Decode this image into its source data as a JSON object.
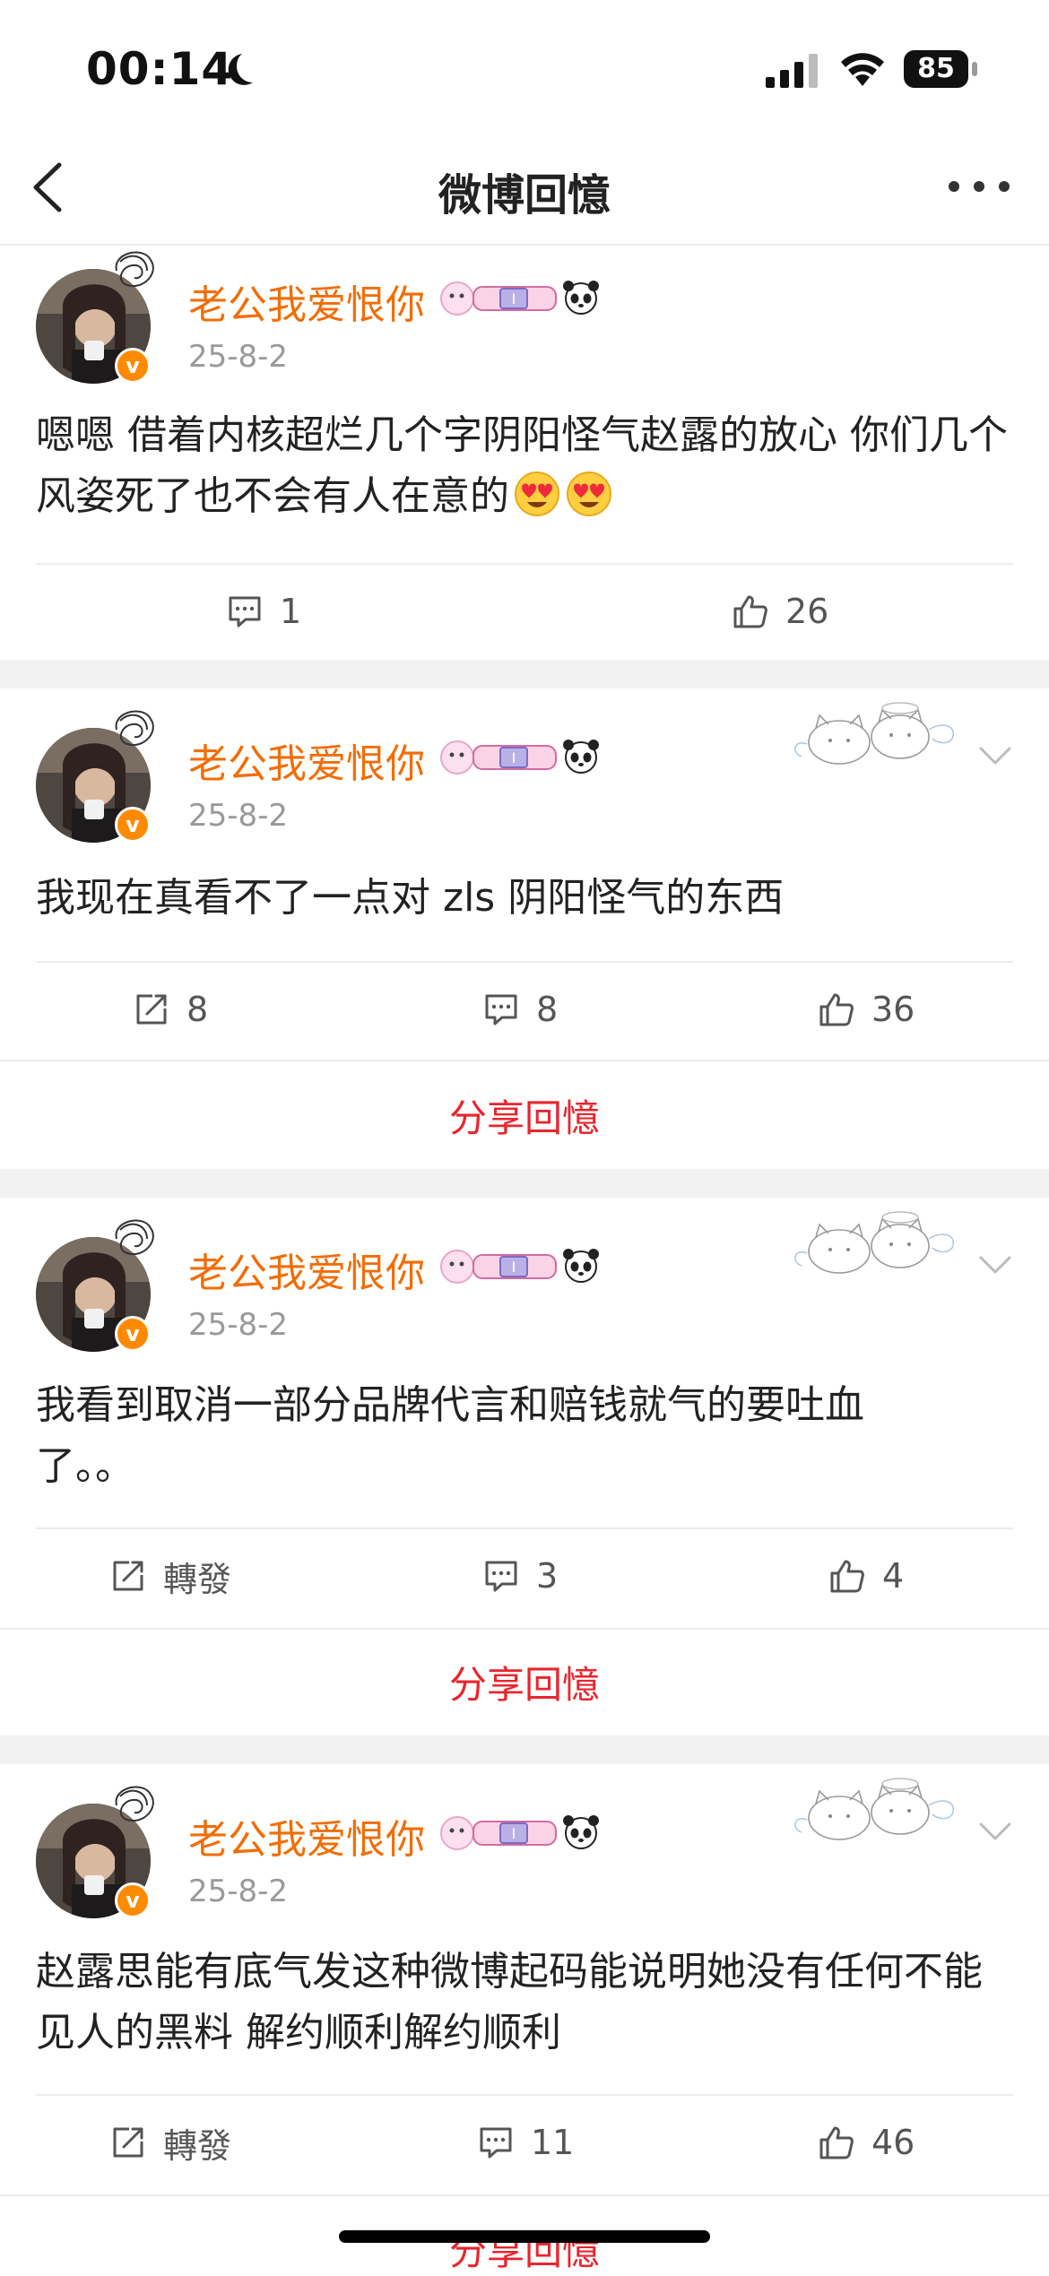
{
  "status_bar": {
    "time": "00:14",
    "battery": "85"
  },
  "nav": {
    "title": "微博回憶"
  },
  "posts": [
    {
      "username": "老公我爱恨你",
      "date": "25-8-2",
      "text": "嗯嗯 借着内核超烂几个字阴阳怪气赵露的放心  你们几个风姿死了也不会有人在意的",
      "comments": "1",
      "likes": "26"
    },
    {
      "username": "老公我爱恨你",
      "date": "25-8-2",
      "text": "我现在真看不了一点对 zls 阴阳怪气的东西",
      "reposts": "8",
      "comments": "8",
      "likes": "36",
      "share": "分享回憶"
    },
    {
      "username": "老公我爱恨你",
      "date": "25-8-2",
      "text": "我看到取消一部分品牌代言和赔钱就气的要吐血了。。",
      "reposts": "轉發",
      "comments": "3",
      "likes": "4",
      "share": "分享回憶"
    },
    {
      "username": "老公我爱恨你",
      "date": "25-8-2",
      "text": "赵露思能有底气发这种微博起码能说明她没有任何不能见人的黑料  解约顺利解约顺利",
      "reposts": "轉發",
      "comments": "11",
      "likes": "46",
      "share": "分享回憶"
    }
  ],
  "colors": {
    "username": "#f26d06",
    "share": "#e8252d",
    "vip": "#ff8a00"
  }
}
